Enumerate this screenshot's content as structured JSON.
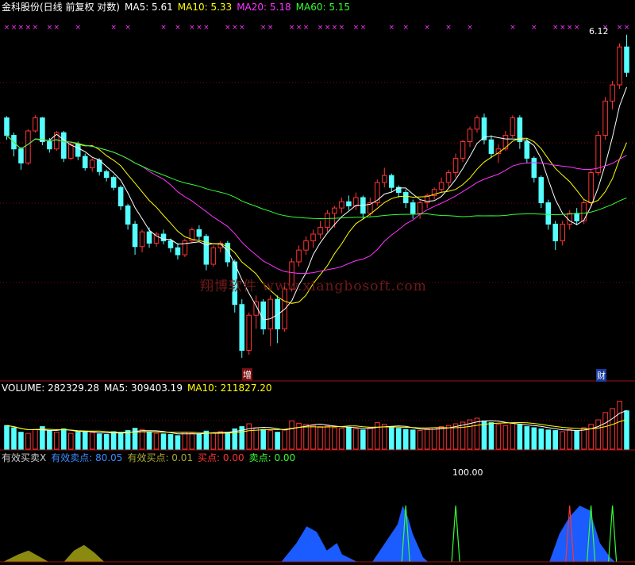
{
  "header": {
    "stock": "金科股份(日线 前复权 对数)",
    "items": [
      {
        "label": "MA5: 5.61",
        "color": "#ffffff"
      },
      {
        "label": "MA10: 5.33",
        "color": "#ffff00"
      },
      {
        "label": "MA20: 5.18",
        "color": "#ff33ff"
      },
      {
        "label": "MA60: 5.15",
        "color": "#33ff33"
      }
    ]
  },
  "volume_header": {
    "items": [
      {
        "label": "VOLUME: 282329.28",
        "color": "#ffffff"
      },
      {
        "label": "MA5: 309403.19",
        "color": "#ffffff"
      },
      {
        "label": "MA10: 211827.20",
        "color": "#ffff00"
      }
    ]
  },
  "indicator_header": {
    "items": [
      {
        "label": "有效买卖X",
        "color": "#cccccc"
      },
      {
        "label": "有效卖点: 80.05",
        "color": "#3a8cff"
      },
      {
        "label": "有效买点: 0.01",
        "color": "#aaaa33"
      },
      {
        "label": "买点: 0.00",
        "color": "#ff3333"
      },
      {
        "label": "卖点: 0.00",
        "color": "#33ff33"
      }
    ]
  },
  "watermark": "翔博软件 www.xiangbosoft.com",
  "annotations": {
    "price_high": "6.12",
    "low_marker": "增",
    "right_marker": "财",
    "indicator_peak": "100.00"
  },
  "colors": {
    "up": "#ff3333",
    "down": "#55ffff",
    "magenta": "#ff33ff",
    "green": "#33ff33",
    "yellow": "#ffff00",
    "blue": "#1a5cff",
    "olive": "#8a8a10"
  },
  "chart_data": {
    "type": "candlestick",
    "bar_count": 88,
    "candles": [
      [
        5.05,
        4.85,
        5.07,
        4.8
      ],
      [
        4.85,
        4.7,
        4.88,
        4.62
      ],
      [
        4.7,
        4.55,
        4.72,
        4.48
      ],
      [
        4.55,
        4.9,
        4.92,
        4.53
      ],
      [
        4.9,
        5.05,
        5.08,
        4.88
      ],
      [
        5.05,
        4.78,
        5.06,
        4.74
      ],
      [
        4.78,
        4.7,
        4.82,
        4.66
      ],
      [
        4.7,
        4.88,
        4.9,
        4.68
      ],
      [
        4.88,
        4.6,
        4.9,
        4.56
      ],
      [
        4.6,
        4.75,
        4.78,
        4.58
      ],
      [
        4.75,
        4.62,
        4.78,
        4.58
      ],
      [
        4.62,
        4.5,
        4.65,
        4.47
      ],
      [
        4.5,
        4.58,
        4.6,
        4.46
      ],
      [
        4.58,
        4.46,
        4.6,
        4.42
      ],
      [
        4.46,
        4.4,
        4.48,
        4.36
      ],
      [
        4.4,
        4.3,
        4.42,
        4.27
      ],
      [
        4.3,
        4.12,
        4.32,
        4.08
      ],
      [
        4.12,
        3.95,
        4.14,
        3.9
      ],
      [
        3.95,
        3.75,
        3.98,
        3.68
      ],
      [
        3.75,
        3.88,
        3.9,
        3.7
      ],
      [
        3.88,
        3.78,
        3.92,
        3.74
      ],
      [
        3.78,
        3.86,
        3.88,
        3.75
      ],
      [
        3.86,
        3.8,
        3.9,
        3.77
      ],
      [
        3.8,
        3.74,
        3.82,
        3.7
      ],
      [
        3.74,
        3.68,
        3.78,
        3.64
      ],
      [
        3.68,
        3.8,
        3.82,
        3.66
      ],
      [
        3.8,
        3.9,
        3.92,
        3.78
      ],
      [
        3.9,
        3.84,
        3.94,
        3.8
      ],
      [
        3.84,
        3.6,
        3.86,
        3.55
      ],
      [
        3.6,
        3.74,
        3.76,
        3.58
      ],
      [
        3.74,
        3.78,
        3.8,
        3.7
      ],
      [
        3.78,
        3.62,
        3.8,
        3.58
      ],
      [
        3.62,
        3.28,
        3.64,
        3.22
      ],
      [
        3.28,
        2.95,
        3.32,
        2.9
      ],
      [
        2.95,
        3.2,
        3.22,
        2.92
      ],
      [
        3.2,
        3.3,
        3.35,
        3.1
      ],
      [
        3.3,
        3.1,
        3.32,
        3.06
      ],
      [
        3.1,
        3.32,
        3.35,
        2.98
      ],
      [
        3.32,
        3.1,
        3.35,
        3.0
      ],
      [
        3.1,
        3.4,
        3.45,
        3.08
      ],
      [
        3.4,
        3.62,
        3.65,
        3.38
      ],
      [
        3.62,
        3.72,
        3.76,
        3.58
      ],
      [
        3.72,
        3.8,
        3.84,
        3.68
      ],
      [
        3.8,
        3.86,
        3.9,
        3.74
      ],
      [
        3.86,
        3.92,
        3.98,
        3.82
      ],
      [
        3.92,
        4.05,
        4.08,
        3.88
      ],
      [
        4.05,
        4.1,
        4.12,
        3.92
      ],
      [
        4.1,
        4.16,
        4.2,
        4.05
      ],
      [
        4.16,
        4.12,
        4.22,
        4.08
      ],
      [
        4.12,
        4.2,
        4.25,
        4.08
      ],
      [
        4.2,
        4.05,
        4.22,
        4.0
      ],
      [
        4.05,
        4.15,
        4.2,
        4.02
      ],
      [
        4.15,
        4.35,
        4.38,
        4.12
      ],
      [
        4.35,
        4.42,
        4.5,
        4.3
      ],
      [
        4.42,
        4.3,
        4.44,
        4.25
      ],
      [
        4.3,
        4.25,
        4.32,
        4.2
      ],
      [
        4.25,
        4.15,
        4.28,
        4.1
      ],
      [
        4.15,
        4.05,
        4.18,
        4.0
      ],
      [
        4.05,
        4.15,
        4.18,
        4.0
      ],
      [
        4.15,
        4.22,
        4.24,
        4.1
      ],
      [
        4.22,
        4.28,
        4.3,
        4.18
      ],
      [
        4.28,
        4.35,
        4.4,
        4.25
      ],
      [
        4.35,
        4.45,
        4.48,
        4.3
      ],
      [
        4.45,
        4.6,
        4.65,
        4.4
      ],
      [
        4.6,
        4.78,
        4.8,
        4.56
      ],
      [
        4.78,
        4.92,
        4.95,
        4.72
      ],
      [
        4.92,
        5.05,
        5.08,
        4.88
      ],
      [
        5.05,
        4.8,
        5.1,
        4.75
      ],
      [
        4.8,
        4.65,
        4.85,
        4.6
      ],
      [
        4.65,
        4.7,
        4.75,
        4.55
      ],
      [
        4.7,
        4.85,
        4.9,
        4.68
      ],
      [
        4.85,
        5.05,
        5.08,
        4.82
      ],
      [
        5.05,
        4.78,
        5.08,
        4.7
      ],
      [
        4.78,
        4.6,
        4.82,
        4.55
      ],
      [
        4.6,
        4.4,
        4.62,
        4.35
      ],
      [
        4.4,
        4.15,
        4.42,
        4.1
      ],
      [
        4.15,
        3.95,
        4.18,
        3.9
      ],
      [
        3.95,
        3.8,
        3.98,
        3.72
      ],
      [
        3.8,
        3.95,
        3.98,
        3.76
      ],
      [
        3.95,
        4.05,
        4.08,
        3.9
      ],
      [
        4.05,
        3.98,
        4.1,
        3.94
      ],
      [
        3.98,
        4.15,
        4.18,
        3.95
      ],
      [
        4.15,
        4.45,
        4.48,
        4.12
      ],
      [
        4.45,
        4.85,
        4.9,
        4.42
      ],
      [
        4.85,
        5.25,
        5.3,
        4.8
      ],
      [
        5.25,
        5.45,
        5.5,
        5.15
      ],
      [
        5.45,
        5.95,
        6.0,
        5.4
      ],
      [
        5.95,
        5.61,
        6.12,
        5.55
      ]
    ],
    "volumes": [
      42,
      38,
      30,
      28,
      35,
      40,
      33,
      30,
      36,
      28,
      30,
      32,
      29,
      27,
      26,
      31,
      29,
      33,
      37,
      35,
      30,
      28,
      27,
      26,
      24,
      30,
      28,
      27,
      32,
      29,
      31,
      30,
      36,
      40,
      45,
      38,
      35,
      33,
      30,
      34,
      50,
      46,
      44,
      42,
      40,
      41,
      38,
      37,
      39,
      36,
      34,
      38,
      47,
      44,
      40,
      37,
      35,
      34,
      33,
      36,
      38,
      40,
      42,
      45,
      48,
      52,
      55,
      50,
      47,
      44,
      42,
      46,
      43,
      40,
      38,
      36,
      34,
      33,
      31,
      35,
      32,
      38,
      44,
      52,
      65,
      72,
      85,
      68
    ],
    "indicator": {
      "type": "area",
      "series": [
        {
          "color": "#1a5cff",
          "points": [
            [
              55,
              0
            ],
            [
              58,
              20
            ],
            [
              60,
              38
            ],
            [
              62,
              32
            ],
            [
              64,
              12
            ],
            [
              66,
              20
            ],
            [
              67,
              8
            ],
            [
              70,
              0
            ],
            [
              73,
              0
            ],
            [
              78,
              40
            ],
            [
              79,
              60
            ],
            [
              80,
              48
            ],
            [
              81,
              30
            ],
            [
              83,
              5
            ],
            [
              84,
              0
            ],
            [
              108,
              0
            ],
            [
              110,
              30
            ],
            [
              112,
              48
            ],
            [
              114,
              60
            ],
            [
              116,
              55
            ],
            [
              118,
              20
            ],
            [
              120,
              5
            ],
            [
              121,
              0
            ]
          ]
        },
        {
          "color": "#8a8a10",
          "points": [
            [
              0,
              0
            ],
            [
              3,
              8
            ],
            [
              5,
              12
            ],
            [
              7,
              6
            ],
            [
              9,
              0
            ],
            [
              12,
              0
            ],
            [
              14,
              12
            ],
            [
              16,
              18
            ],
            [
              18,
              10
            ],
            [
              20,
              0
            ]
          ]
        },
        {
          "color": "#33ff33",
          "spikes": [
            56,
            63,
            82,
            85
          ]
        },
        {
          "color": "#ff3333",
          "spikes": [
            79
          ]
        }
      ],
      "ylim": [
        0,
        100
      ]
    },
    "ylim_price": [
      2.8,
      6.3
    ],
    "ylim_volume": [
      0,
      100
    ]
  }
}
